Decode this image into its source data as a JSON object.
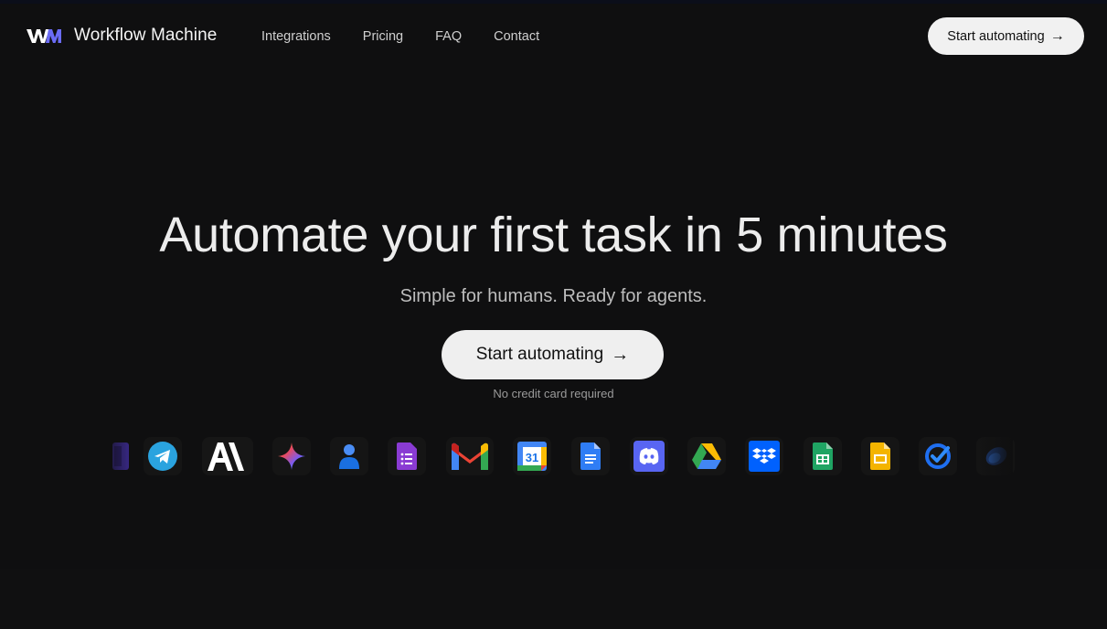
{
  "brand": {
    "logo_alt": "WM",
    "name": "Workflow Machine"
  },
  "nav": {
    "links": [
      "Integrations",
      "Pricing",
      "FAQ",
      "Contact"
    ],
    "cta_label": "Start automating",
    "cta_arrow": "→"
  },
  "hero": {
    "title": "Automate your first task in 5 minutes",
    "subtitle": "Simple for humans. Ready for agents.",
    "cta_label": "Start automating",
    "cta_arrow": "→",
    "note": "No credit card required"
  },
  "integrations": [
    "partial-purple-app-icon",
    "telegram-icon",
    "anthropic-icon",
    "gemini-icon",
    "google-contacts-icon",
    "google-forms-icon",
    "gmail-icon",
    "google-calendar-icon",
    "google-docs-icon",
    "discord-icon",
    "google-drive-icon",
    "dropbox-icon",
    "google-sheets-icon",
    "google-slides-icon",
    "google-tasks-icon",
    "partial-blue-app-icon"
  ],
  "calendar_day": "31",
  "colors": {
    "background": "#0f0f10",
    "button_bg": "#f1f1f1",
    "logo_w": "#ffffff",
    "logo_m": "#6b6cf5"
  }
}
